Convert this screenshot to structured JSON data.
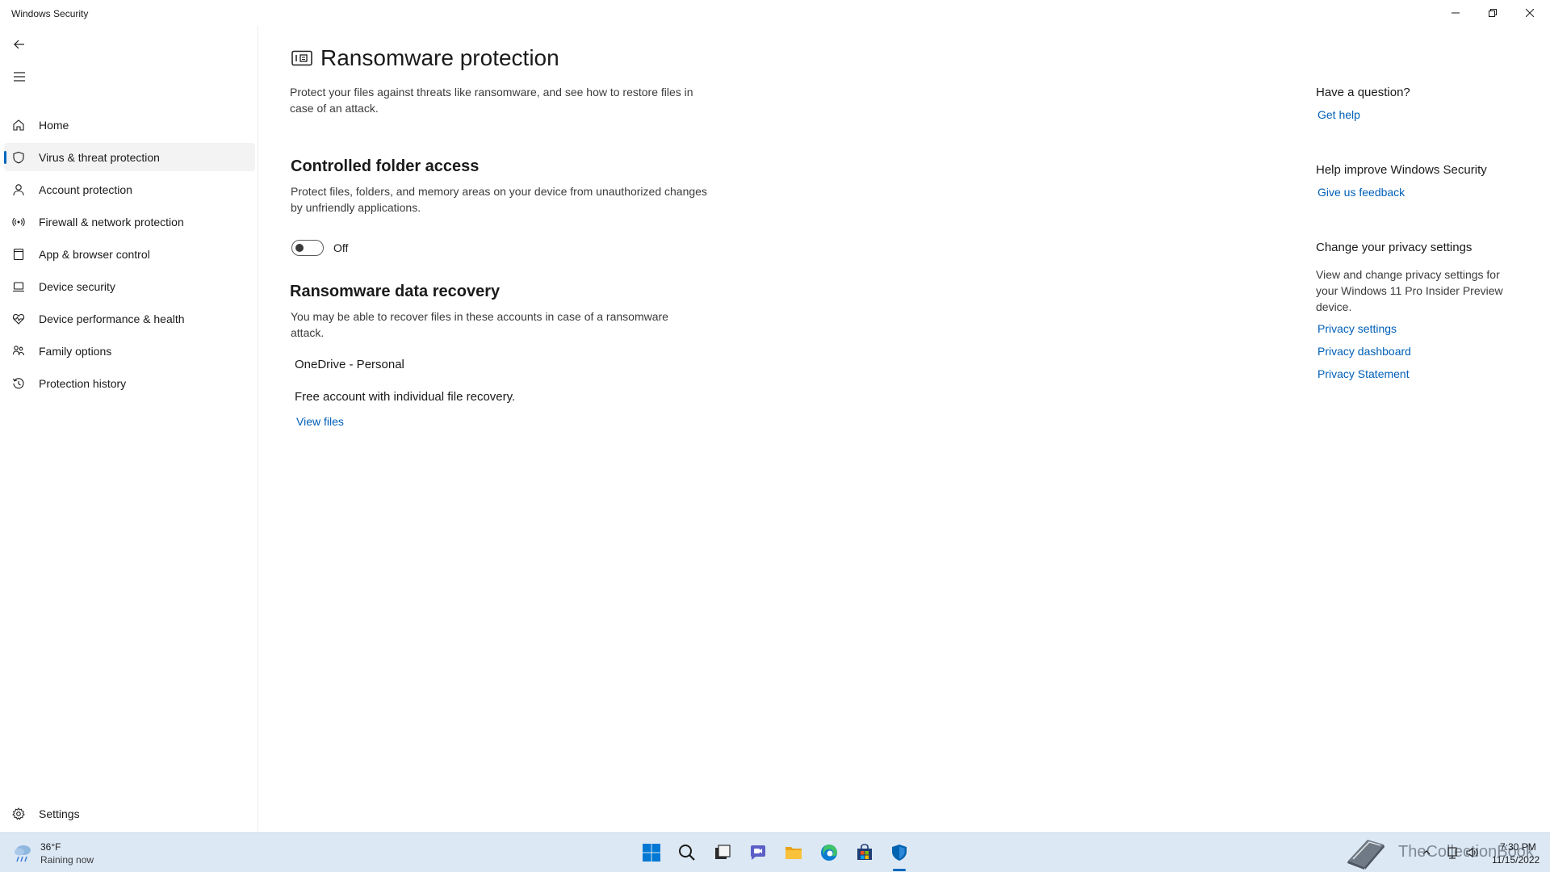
{
  "window": {
    "title": "Windows Security",
    "controls": [
      "minimize",
      "restore",
      "close"
    ]
  },
  "sidebar": {
    "back_icon": "back-arrow-icon",
    "menu_icon": "hamburger-menu-icon",
    "items": [
      {
        "label": "Home",
        "icon": "home-icon",
        "selected": false
      },
      {
        "label": "Virus & threat protection",
        "icon": "shield-icon",
        "selected": true
      },
      {
        "label": "Account protection",
        "icon": "person-icon",
        "selected": false
      },
      {
        "label": "Firewall & network protection",
        "icon": "wireless-signal-icon",
        "selected": false
      },
      {
        "label": "App & browser control",
        "icon": "app-window-icon",
        "selected": false
      },
      {
        "label": "Device security",
        "icon": "laptop-icon",
        "selected": false
      },
      {
        "label": "Device performance & health",
        "icon": "heart-pulse-icon",
        "selected": false
      },
      {
        "label": "Family options",
        "icon": "family-icon",
        "selected": false
      },
      {
        "label": "Protection history",
        "icon": "history-icon",
        "selected": false
      }
    ],
    "settings_label": "Settings"
  },
  "main": {
    "title": "Ransomware protection",
    "description": "Protect your files against threats like ransomware, and see how to restore files in case of an attack.",
    "controlled_folder": {
      "title": "Controlled folder access",
      "description": "Protect files, folders, and memory areas on your device from unauthorized changes by unfriendly applications.",
      "toggle_state": "Off"
    },
    "recovery": {
      "title": "Ransomware data recovery",
      "description": "You may be able to recover files in these accounts in case of a ransomware attack.",
      "account_name": "OneDrive - Personal",
      "account_detail": "Free account with individual file recovery.",
      "view_files_link": "View files"
    }
  },
  "right_column": {
    "question_heading": "Have a question?",
    "get_help_link": "Get help",
    "improve_heading": "Help improve Windows Security",
    "feedback_link": "Give us feedback",
    "privacy_heading": "Change your privacy settings",
    "privacy_text": "View and change privacy settings for your Windows 11 Pro Insider Preview device.",
    "privacy_settings_link": "Privacy settings",
    "privacy_dashboard_link": "Privacy dashboard",
    "privacy_statement_link": "Privacy Statement"
  },
  "taskbar": {
    "weather_temp": "36°F",
    "weather_desc": "Raining now",
    "apps": [
      "start-icon",
      "search-icon",
      "task-view-icon",
      "chat-icon",
      "file-explorer-icon",
      "edge-icon",
      "store-icon",
      "windows-security-icon"
    ],
    "watermark": "TheCollectionBook",
    "time": "7:30 PM",
    "date": "11/15/2022"
  },
  "colors": {
    "accent": "#0067c0",
    "link": "#005fb8",
    "taskbar": "#dce8f4"
  }
}
